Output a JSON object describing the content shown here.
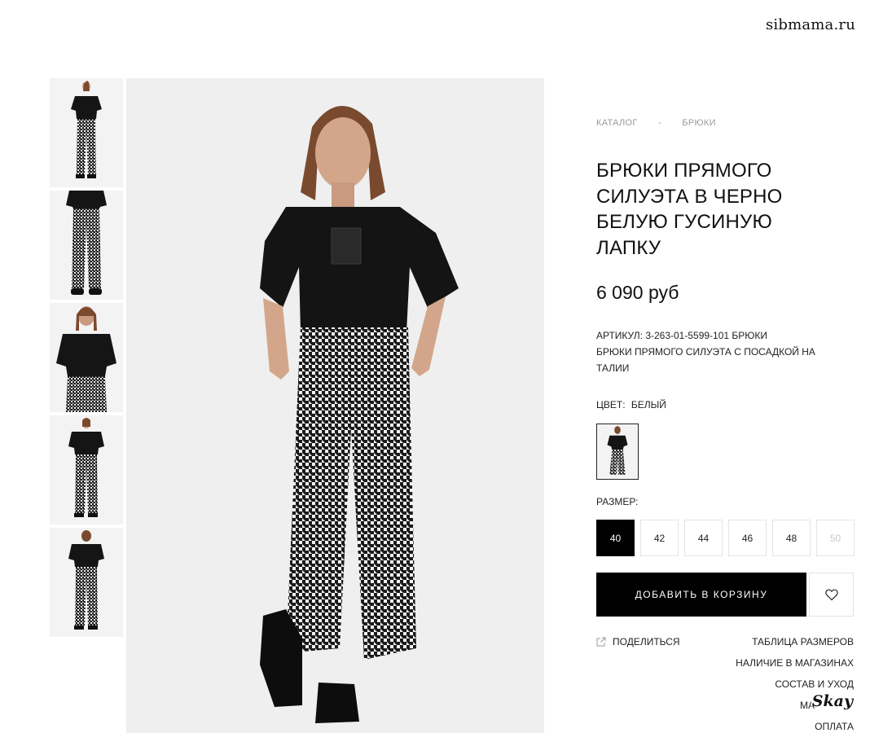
{
  "watermark": "sibmama.ru",
  "gallery": {
    "thumbnails": [
      "thumb-front-black-tee",
      "thumb-pants-close",
      "thumb-top-close",
      "thumb-full-front",
      "thumb-back-view"
    ]
  },
  "breadcrumb": {
    "items": [
      "КАТАЛОГ",
      "БРЮКИ"
    ],
    "separator": "-"
  },
  "product": {
    "title_lines": [
      "БРЮКИ ПРЯМОГО",
      "СИЛУЭТА В ЧЕРНО",
      "БЕЛУЮ ГУСИНУЮ",
      "ЛАПКУ"
    ],
    "price": "6 090 руб",
    "article": "АРТИКУЛ: 3-263-01-5599-101 БРЮКИ",
    "description": "БРЮКИ ПРЯМОГО СИЛУЭТА С ПОСАДКОЙ НА ТАЛИИ"
  },
  "color": {
    "label": "ЦВЕТ:",
    "value": "БЕЛЫЙ"
  },
  "size": {
    "label": "РАЗМЕР:",
    "options": [
      {
        "label": "40",
        "state": "active"
      },
      {
        "label": "42",
        "state": "available"
      },
      {
        "label": "44",
        "state": "available"
      },
      {
        "label": "46",
        "state": "available"
      },
      {
        "label": "48",
        "state": "available"
      },
      {
        "label": "50",
        "state": "disabled"
      }
    ]
  },
  "actions": {
    "add_to_cart": "ДОБАВИТЬ В КОРЗИНУ",
    "wishlist_icon": "heart-icon"
  },
  "share": {
    "label": "ПОДЕЛИТЬСЯ",
    "icon": "share-icon"
  },
  "info_links": [
    "ТАБЛИЦА РАЗМЕРОВ",
    "НАЛИЧИЕ В МАГАЗИНАХ",
    "СОСТАВ И УХОД",
    "МА",
    "ОПЛАТА"
  ],
  "logo_overlay": "Skay",
  "colors": {
    "accent": "#000000",
    "muted": "#9a9a9a",
    "border": "#e3e3e3",
    "photo_bg": "#eeeeee"
  }
}
